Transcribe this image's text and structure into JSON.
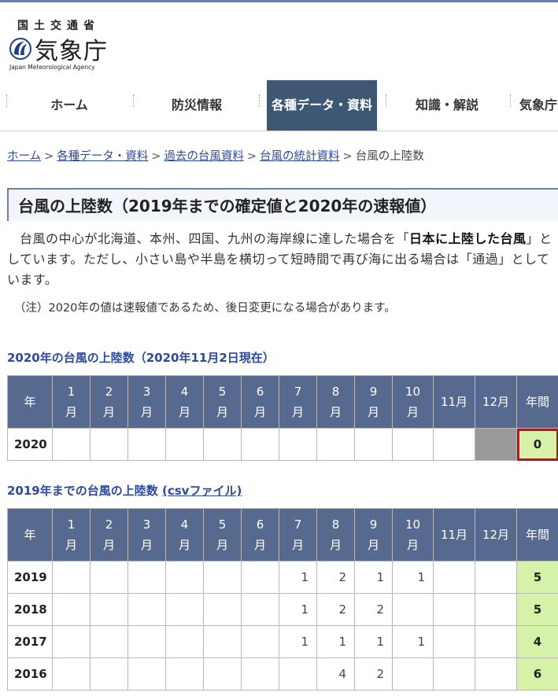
{
  "agency": {
    "kanji_small": "国土交通省",
    "name": "気象庁",
    "name_en": "Japan Meteorological Agency"
  },
  "nav": {
    "items": [
      {
        "label": "ホーム"
      },
      {
        "label": "防災情報"
      },
      {
        "label": "各種データ・資料"
      },
      {
        "label": "知識・解説"
      },
      {
        "label": "気象庁"
      }
    ]
  },
  "breadcrumb": {
    "links": [
      "ホーム",
      "各種データ・資料",
      "過去の台風資料",
      "台風の統計資料"
    ],
    "current": "台風の上陸数",
    "separator": ">"
  },
  "page": {
    "title": "台風の上陸数（2019年までの確定値と2020年の速報値）",
    "intro_1": "台風の中心が北海道、本州、四国、九州の海岸線に達した場合を「",
    "intro_bold": "日本に上陸した台風",
    "intro_2": "」としています。ただし、小さい島や半島を横切って短時間で再び海に出る場合は「通過」としています。",
    "note": "（注）2020年の値は速報値であるため、後日変更になる場合があります。"
  },
  "table_2020": {
    "heading": "2020年の台風の上陸数（2020年11月2日現在）",
    "row": {
      "year": "2020",
      "months": [
        "",
        "",
        "",
        "",
        "",
        "",
        "",
        "",
        "",
        "",
        "",
        ""
      ],
      "total": "0"
    }
  },
  "table_history": {
    "heading": "2019年までの台風の上陸数",
    "csv_link": "(csvファイル)",
    "rows": [
      {
        "year": "2019",
        "months": [
          "",
          "",
          "",
          "",
          "",
          "",
          "1",
          "2",
          "1",
          "1",
          "",
          ""
        ],
        "total": "5"
      },
      {
        "year": "2018",
        "months": [
          "",
          "",
          "",
          "",
          "",
          "",
          "1",
          "2",
          "2",
          "",
          "",
          ""
        ],
        "total": "5"
      },
      {
        "year": "2017",
        "months": [
          "",
          "",
          "",
          "",
          "",
          "",
          "1",
          "1",
          "1",
          "1",
          "",
          ""
        ],
        "total": "4"
      },
      {
        "year": "2016",
        "months": [
          "",
          "",
          "",
          "",
          "",
          "",
          "",
          "4",
          "2",
          "",
          "",
          ""
        ],
        "total": "6"
      }
    ]
  },
  "table_headers": {
    "year": "年",
    "month_nums": [
      "1",
      "2",
      "3",
      "4",
      "5",
      "6",
      "7",
      "8",
      "9",
      "10",
      "11月",
      "12月"
    ],
    "month_suffix": "月",
    "total": "年間"
  },
  "colors": {
    "header_bg": "#56698f",
    "nav_active_bg": "#3d5774",
    "total_bg": "#d6f1a8",
    "highlight": "#e0001e",
    "link": "#2b4aa0"
  }
}
